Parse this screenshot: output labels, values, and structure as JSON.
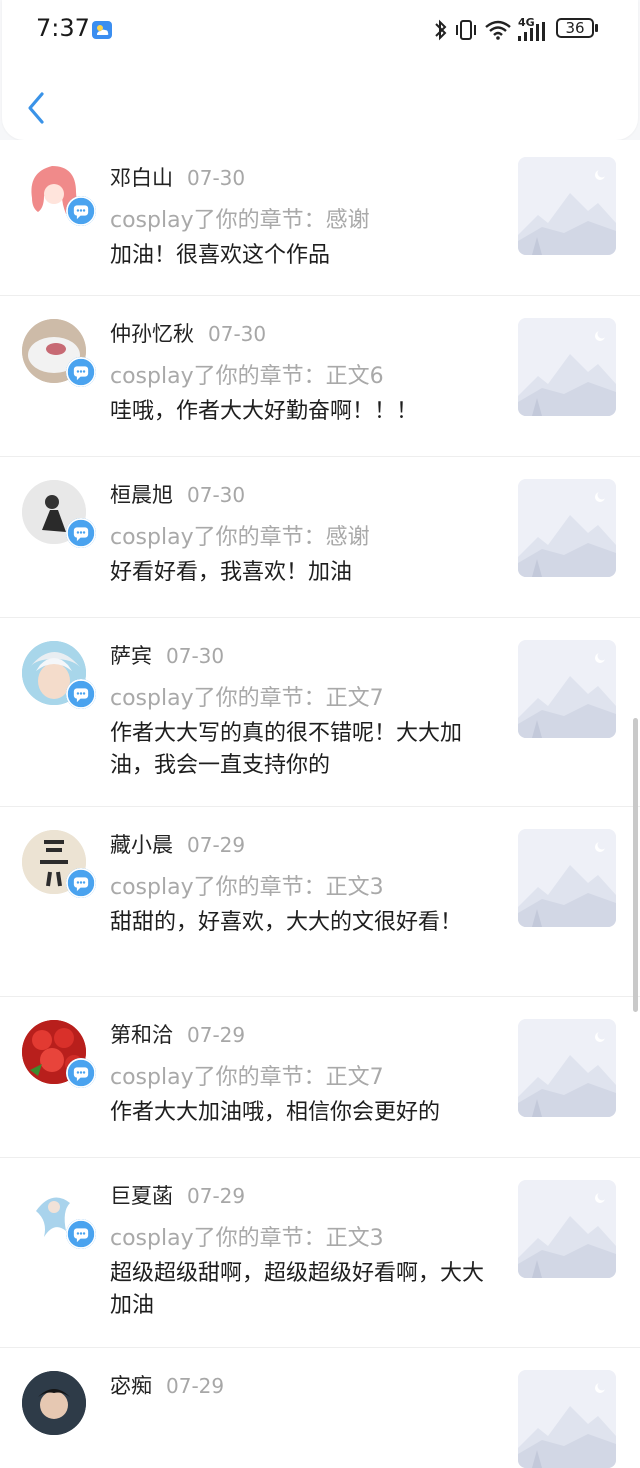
{
  "status_bar": {
    "time": "7:37",
    "network": "4G",
    "battery": "36",
    "icons": [
      "weather-icon",
      "bluetooth-icon",
      "vibrate-icon",
      "wifi-icon",
      "signal-icon",
      "battery-icon"
    ]
  },
  "header": {
    "back_icon": "chevron-left-icon"
  },
  "colors": {
    "accent": "#4aa3ef",
    "muted": "#a9a9a9",
    "divider": "#eeeeee"
  },
  "items": [
    {
      "name": "邓白山",
      "date": "07-30",
      "action": "cosplay了你的章节：感谢",
      "comment": "加油！很喜欢这个作品"
    },
    {
      "name": "仲孙忆秋",
      "date": "07-30",
      "action": "cosplay了你的章节：正文6",
      "comment": "哇哦，作者大大好勤奋啊！！！"
    },
    {
      "name": "桓晨旭",
      "date": "07-30",
      "action": "cosplay了你的章节：感谢",
      "comment": "好看好看，我喜欢！加油"
    },
    {
      "name": "萨宾",
      "date": "07-30",
      "action": "cosplay了你的章节：正文7",
      "comment": "作者大大写的真的很不错呢！大大加油，我会一直支持你的"
    },
    {
      "name": "藏小晨",
      "date": "07-29",
      "action": "cosplay了你的章节：正文3",
      "comment": "甜甜的，好喜欢，大大的文很好看！"
    },
    {
      "name": "第和洽",
      "date": "07-29",
      "action": "cosplay了你的章节：正文7",
      "comment": "作者大大加油哦，相信你会更好的"
    },
    {
      "name": "巨夏菡",
      "date": "07-29",
      "action": "cosplay了你的章节：正文3",
      "comment": "超级超级甜啊，超级超级好看啊，大大加油"
    },
    {
      "name": "宓痴",
      "date": "07-29",
      "action": "",
      "comment": ""
    }
  ]
}
